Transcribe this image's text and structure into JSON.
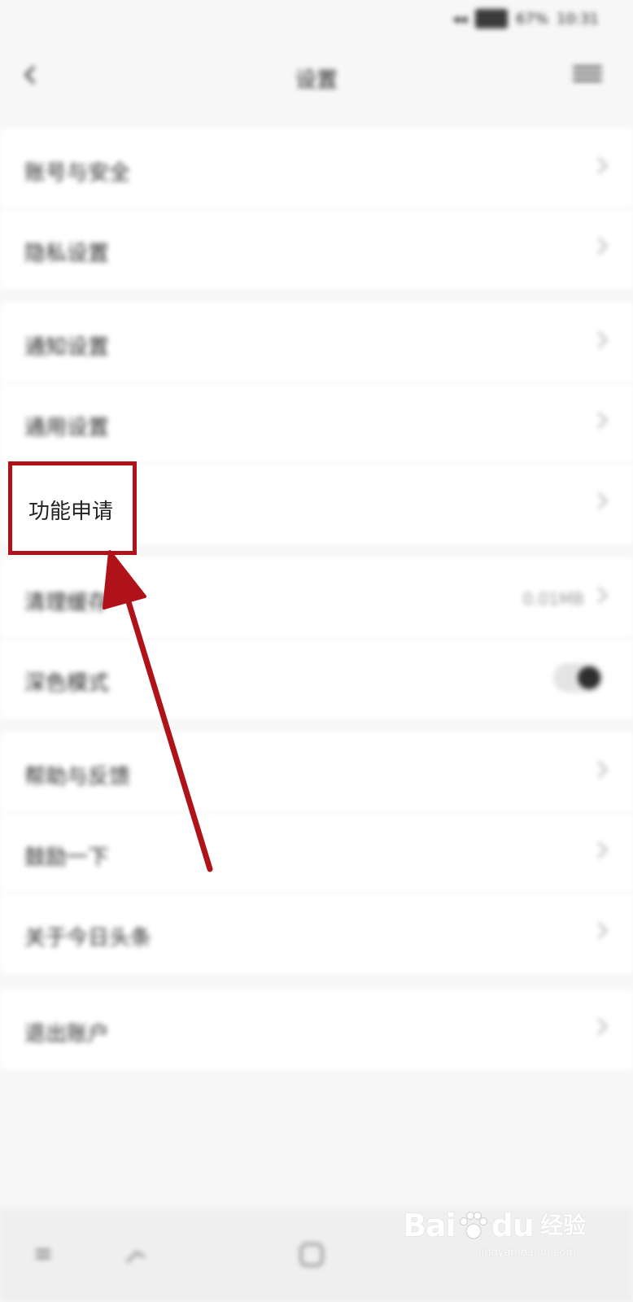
{
  "status_bar": {
    "time": "10:31",
    "battery": "67%"
  },
  "header": {
    "title": "设置"
  },
  "groups": [
    {
      "items": [
        {
          "label": "账号与安全"
        },
        {
          "label": "隐私设置"
        }
      ]
    },
    {
      "items": [
        {
          "label": "通知设置"
        },
        {
          "label": "通用设置"
        },
        {
          "label": "功能申请"
        }
      ]
    },
    {
      "items": [
        {
          "label": "清理缓存",
          "value": "0.01MB"
        },
        {
          "label": "深色模式"
        }
      ]
    },
    {
      "items": [
        {
          "label": "帮助与反馈"
        },
        {
          "label": "鼓励一下"
        },
        {
          "label": "关于今日头条"
        }
      ]
    },
    {
      "items": [
        {
          "label": "退出账户"
        }
      ]
    }
  ],
  "highlight": {
    "label": "功能申请"
  },
  "watermark": {
    "brand_left": "Bai",
    "brand_right": "du",
    "suffix": "经验",
    "url": "jingyan.baidu.com"
  },
  "colors": {
    "annotation": "#b01219",
    "page_bg": "#f7f7f7",
    "row_bg": "#ffffff"
  },
  "icons": [
    "back-icon",
    "menu-icon",
    "chevron-right-icon",
    "toggle-switch",
    "paw-icon"
  ]
}
